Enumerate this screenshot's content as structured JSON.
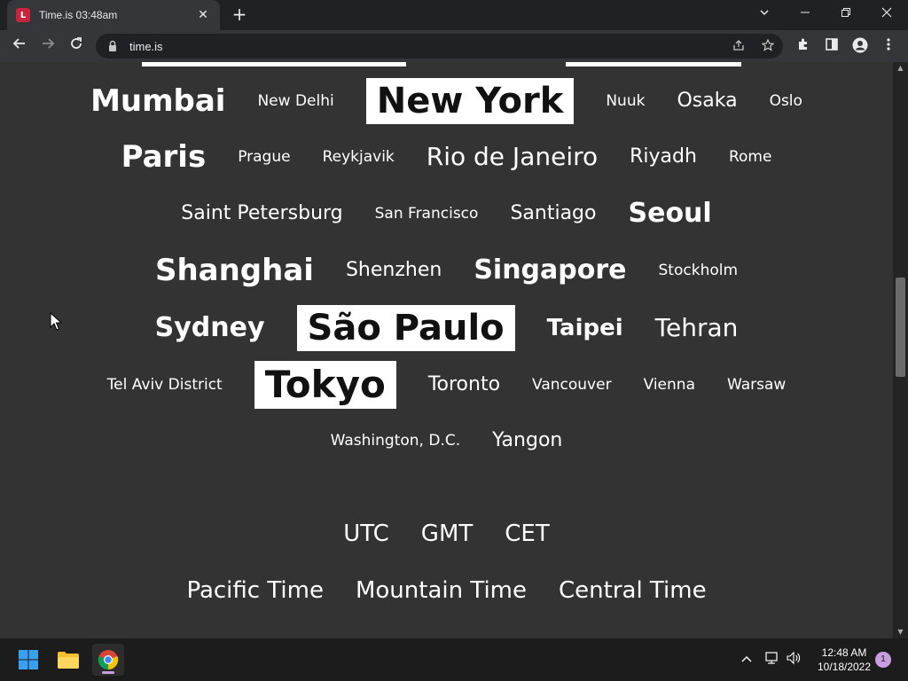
{
  "browser": {
    "tab_title": "Time.is 03:48am",
    "favicon_text": "L",
    "url": "time.is",
    "new_tab_symbol": "+",
    "tab_close_symbol": "✕"
  },
  "cities": {
    "row1": [
      "Mumbai",
      "New Delhi",
      "New York",
      "Nuuk",
      "Osaka",
      "Oslo"
    ],
    "row2": [
      "Paris",
      "Prague",
      "Reykjavik",
      "Rio de Janeiro",
      "Riyadh",
      "Rome"
    ],
    "row3": [
      "Saint Petersburg",
      "San Francisco",
      "Santiago",
      "Seoul"
    ],
    "row4": [
      "Shanghai",
      "Shenzhen",
      "Singapore",
      "Stockholm"
    ],
    "row5": [
      "Sydney",
      "São Paulo",
      "Taipei",
      "Tehran"
    ],
    "row6": [
      "Tel Aviv District",
      "Tokyo",
      "Toronto",
      "Vancouver",
      "Vienna",
      "Warsaw"
    ],
    "row7": [
      "Washington, D.C.",
      "Yangon"
    ]
  },
  "timezones": {
    "row1": [
      "UTC",
      "GMT",
      "CET"
    ],
    "row2": [
      "Pacific Time",
      "Mountain Time",
      "Central Time"
    ]
  },
  "taskbar": {
    "time": "12:48 AM",
    "date": "10/18/2022",
    "notification_count": "1"
  },
  "colors": {
    "page_bg": "#333333",
    "highlight_bg": "#ffffff",
    "tab_favicon": "#c8243c",
    "taskbar_accent": "#c99ee0"
  }
}
